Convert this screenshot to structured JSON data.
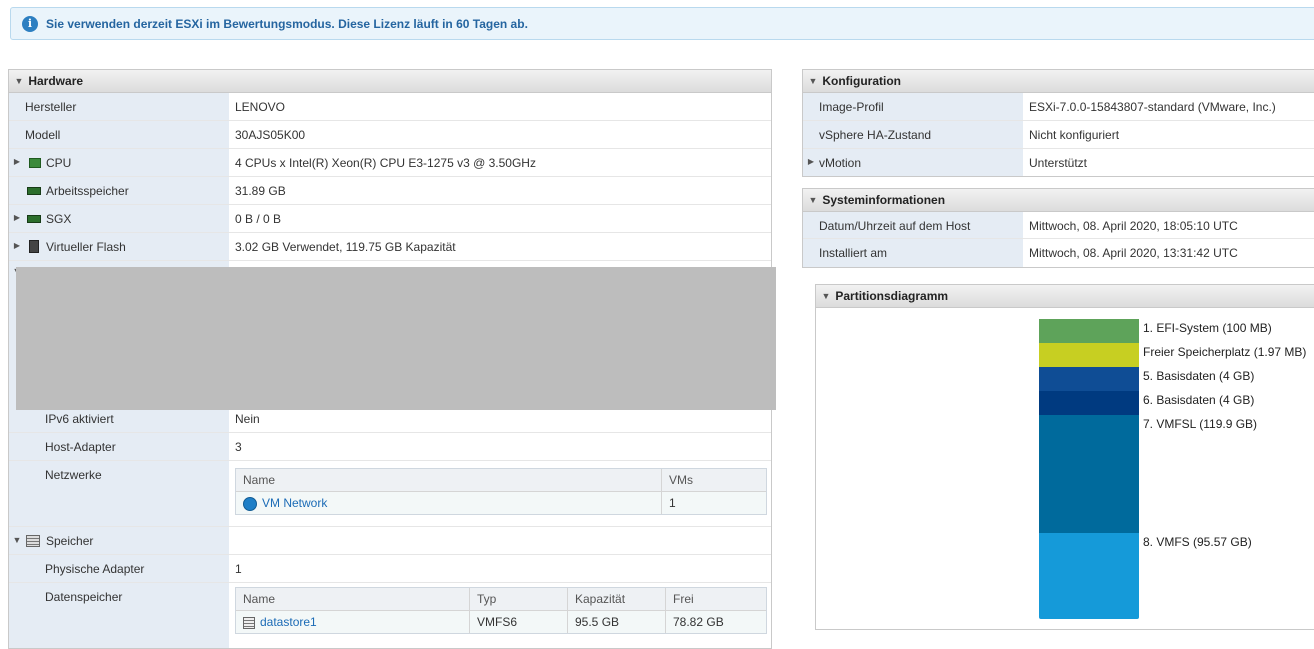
{
  "banner": {
    "message": "Sie verwenden derzeit ESXi im Bewertungsmodus. Diese Lizenz läuft in 60 Tagen ab."
  },
  "hardware": {
    "title": "Hardware",
    "rows": [
      {
        "label": "Hersteller",
        "value": "LENOVO"
      },
      {
        "label": "Modell",
        "value": "30AJS05K00"
      },
      {
        "label": "CPU",
        "value": "4 CPUs x Intel(R) Xeon(R) CPU E3-1275 v3 @ 3.50GHz"
      },
      {
        "label": "Arbeitsspeicher",
        "value": "31.89 GB"
      },
      {
        "label": "SGX",
        "value": "0 B / 0 B"
      },
      {
        "label": "Virtueller Flash",
        "value": "3.02 GB Verwendet, 119.75 GB Kapazität"
      }
    ],
    "network": {
      "ipv6_label": "IPv6 aktiviert",
      "ipv6_value": "Nein",
      "host_adapter_label": "Host-Adapter",
      "host_adapter_value": "3",
      "networks_label": "Netzwerke",
      "table": {
        "col_name": "Name",
        "col_vms": "VMs",
        "row_name": "VM Network",
        "row_vms": "1"
      }
    },
    "storage": {
      "label": "Speicher",
      "phys_label": "Physische Adapter",
      "phys_value": "1",
      "ds_label": "Datenspeicher",
      "table": {
        "col_name": "Name",
        "col_type": "Typ",
        "col_capacity": "Kapazität",
        "col_free": "Frei",
        "row_name": "datastore1",
        "row_type": "VMFS6",
        "row_capacity": "95.5 GB",
        "row_free": "78.82 GB"
      }
    }
  },
  "config": {
    "title": "Konfiguration",
    "rows": [
      {
        "label": "Image-Profil",
        "value": "ESXi-7.0.0-15843807-standard (VMware, Inc.)"
      },
      {
        "label": "vSphere HA-Zustand",
        "value": "Nicht konfiguriert"
      },
      {
        "label": "vMotion",
        "value": "Unterstützt"
      }
    ]
  },
  "sysinfo": {
    "title": "Systeminformationen",
    "rows": [
      {
        "label": "Datum/Uhrzeit auf dem Host",
        "value": "Mittwoch, 08. April 2020, 18:05:10 UTC"
      },
      {
        "label": "Installiert am",
        "value": "Mittwoch, 08. April 2020, 13:31:42 UTC"
      }
    ]
  },
  "partitions": {
    "title": "Partitionsdiagramm",
    "items": [
      {
        "label": "1. EFI-System  (100 MB)",
        "color": "#5ea35a"
      },
      {
        "label": "Freier Speicherplatz  (1.97 MB)",
        "color": "#c7cf22"
      },
      {
        "label": "5. Basisdaten  (4 GB)",
        "color": "#0f4d95"
      },
      {
        "label": "6. Basisdaten  (4 GB)",
        "color": "#003a80"
      },
      {
        "label": "7. VMFSL  (119.9 GB)",
        "color": "#006a9c"
      },
      {
        "label": "8. VMFS  (95.57 GB)",
        "color": "#159ad9"
      }
    ]
  }
}
